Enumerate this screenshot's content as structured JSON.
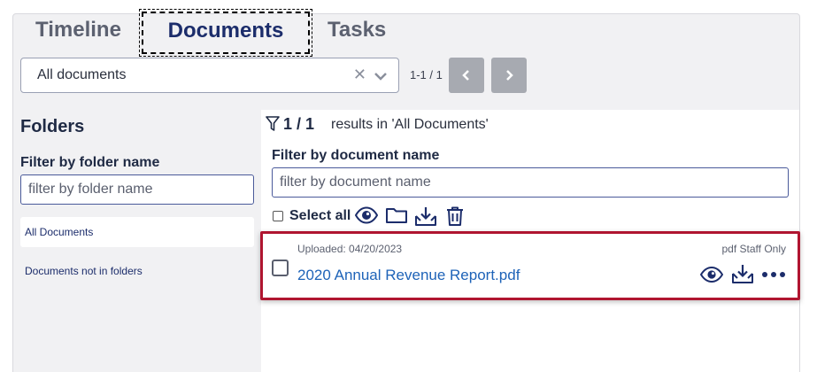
{
  "tabs": [
    {
      "label": "Timeline"
    },
    {
      "label": "Documents"
    },
    {
      "label": "Tasks"
    }
  ],
  "doc_filter_select": {
    "value": "All documents"
  },
  "pager": {
    "range": "1-1 / 1"
  },
  "folders": {
    "title": "Folders",
    "filter_label": "Filter by folder name",
    "filter_placeholder": "filter by folder name",
    "items": [
      {
        "label": "All Documents"
      },
      {
        "label": "Documents not in folders"
      }
    ]
  },
  "results": {
    "count": "1 / 1",
    "text": "results in 'All Documents'"
  },
  "doc_name_filter": {
    "label": "Filter by document name",
    "placeholder": "filter by document name"
  },
  "bulk": {
    "select_all_label": "Select all"
  },
  "documents": [
    {
      "uploaded": "Uploaded: 04/20/2023",
      "meta": "pdf Staff Only",
      "title": "2020 Annual Revenue Report.pdf"
    }
  ],
  "colors": {
    "accent": "#1c2d6b",
    "link": "#1e63b8",
    "highlight_border": "#b01530",
    "pager_button": "#a7aab1"
  }
}
